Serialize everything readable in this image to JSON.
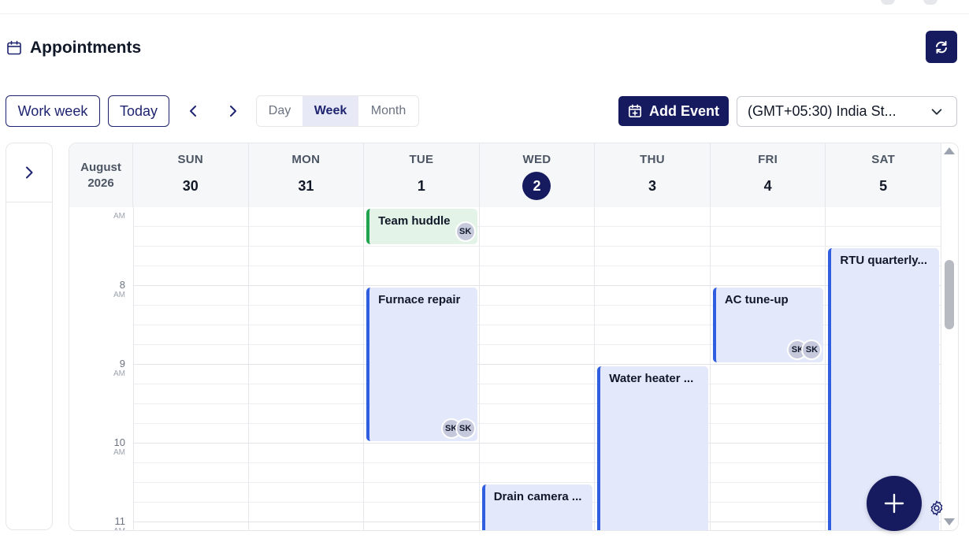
{
  "header": {
    "title": "Appointments"
  },
  "toolbar": {
    "work_week_label": "Work week",
    "today_label": "Today",
    "views": [
      "Day",
      "Week",
      "Month"
    ],
    "active_view": "Week",
    "add_event_label": "Add Event",
    "timezone_value": "(GMT+05:30) India St..."
  },
  "calendar": {
    "month": "August",
    "year": "2026",
    "days": [
      {
        "name": "SUN",
        "num": "30"
      },
      {
        "name": "MON",
        "num": "31"
      },
      {
        "name": "TUE",
        "num": "1"
      },
      {
        "name": "WED",
        "num": "2",
        "today": true
      },
      {
        "name": "THU",
        "num": "3"
      },
      {
        "name": "FRI",
        "num": "4"
      },
      {
        "name": "SAT",
        "num": "5"
      }
    ],
    "hours": [
      {
        "h": "8",
        "ampm": "AM"
      },
      {
        "h": "9",
        "ampm": "AM"
      },
      {
        "h": "10",
        "ampm": "AM"
      },
      {
        "h": "11",
        "ampm": "AM"
      }
    ],
    "partial_top_ampm": "AM",
    "events": [
      {
        "title": "Team huddle",
        "day": 2,
        "start": 7.0,
        "end": 7.5,
        "color": "green",
        "avatars": [
          "SK"
        ]
      },
      {
        "title": "Furnace repair",
        "day": 2,
        "start": 8.0,
        "end": 10.0,
        "color": "blue",
        "avatars": [
          "SK",
          "SK"
        ]
      },
      {
        "title": "AC tune-up",
        "day": 5,
        "start": 8.0,
        "end": 9.0,
        "color": "blue",
        "avatars": [
          "SK",
          "SK"
        ]
      },
      {
        "title": "RTU quarterly...",
        "day": 6,
        "start": 7.5,
        "end": 11.2,
        "color": "blue",
        "avatars": []
      },
      {
        "title": "Water heater ...",
        "day": 4,
        "start": 9.0,
        "end": 11.2,
        "color": "blue",
        "avatars": []
      },
      {
        "title": "Drain camera ...",
        "day": 3,
        "start": 10.5,
        "end": 11.2,
        "color": "blue",
        "avatars": []
      }
    ]
  },
  "colors": {
    "primary": "#161a5e",
    "event_blue_bg": "#e3e8fb",
    "event_blue_border": "#2f5fe0",
    "event_green_bg": "#e3f3e8",
    "event_green_border": "#23a24f"
  }
}
